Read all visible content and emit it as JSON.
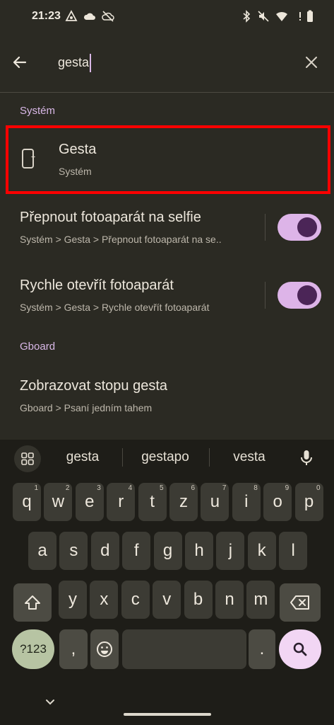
{
  "status_bar": {
    "time": "21:23",
    "left_icons": [
      "assistant-icon",
      "cloud-icon",
      "cloud-off-icon"
    ],
    "right_icons": [
      "bluetooth-icon",
      "mute-icon",
      "wifi-icon",
      "battery-icon"
    ]
  },
  "search": {
    "query": "gesta",
    "back_icon": "arrow-left-icon",
    "clear_icon": "close-icon"
  },
  "sections": [
    {
      "header": "Systém",
      "results": [
        {
          "title": "Gesta",
          "path": "Systém",
          "icon": "phone-gesture-icon",
          "highlighted": true
        },
        {
          "title": "Přepnout fotoaparát na selfie",
          "path": "Systém > Gesta > Přepnout fotoaparát na se..",
          "toggle_on": true
        },
        {
          "title": "Rychle otevřít fotoaparát",
          "path": "Systém > Gesta > Rychle otevřít fotoaparát",
          "toggle_on": true
        }
      ]
    },
    {
      "header": "Gboard",
      "results": [
        {
          "title": "Zobrazovat stopu gesta",
          "path": "Gboard > Psaní jedním tahem"
        }
      ]
    }
  ],
  "keyboard": {
    "suggestions": [
      "gesta",
      "gestapo",
      "vesta"
    ],
    "row1": [
      {
        "k": "q",
        "h": "1"
      },
      {
        "k": "w",
        "h": "2"
      },
      {
        "k": "e",
        "h": "3"
      },
      {
        "k": "r",
        "h": "4"
      },
      {
        "k": "t",
        "h": "5"
      },
      {
        "k": "z",
        "h": "6"
      },
      {
        "k": "u",
        "h": "7"
      },
      {
        "k": "i",
        "h": "8"
      },
      {
        "k": "o",
        "h": "9"
      },
      {
        "k": "p",
        "h": "0"
      }
    ],
    "row2": [
      "a",
      "s",
      "d",
      "f",
      "g",
      "h",
      "j",
      "k",
      "l"
    ],
    "row3": [
      "y",
      "x",
      "c",
      "v",
      "b",
      "n",
      "m"
    ],
    "symbols_key": "?123",
    "comma_key": ",",
    "period_key": ".",
    "emoji_icon": "emoji-icon",
    "search_icon": "search-icon"
  },
  "colors": {
    "accent": "#d8b7e6",
    "toggle_track": "#ddb4e8",
    "toggle_knob": "#4b2557",
    "highlight_border": "#ff0000",
    "background": "#2b2a23"
  }
}
